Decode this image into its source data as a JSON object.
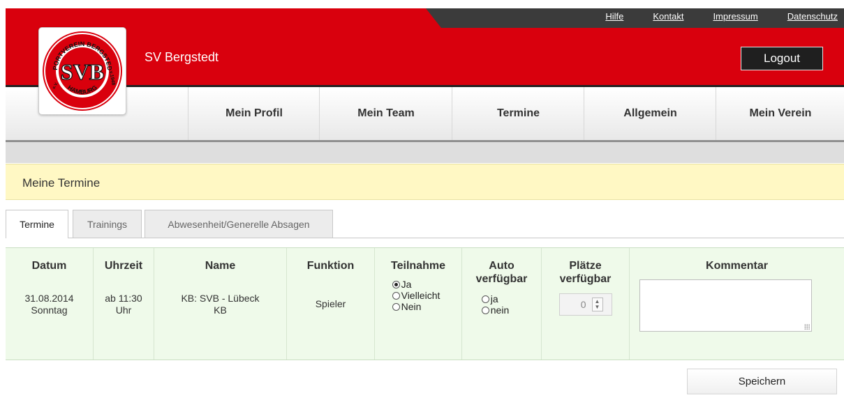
{
  "header": {
    "club_name": "SV Bergstedt",
    "logout_label": "Logout",
    "top_links": [
      "Hilfe",
      "Kontakt",
      "Impressum",
      "Datenschutz"
    ],
    "logo": {
      "top_text": "SPORTVEREIN BERGSTEDT",
      "center_text": "SVB",
      "year_text": "v.1948",
      "bottom_text": "HAMBURG",
      "suffix": "e.V."
    },
    "colors": {
      "brand_red": "#d9000d",
      "topbar": "#3b3b3b"
    }
  },
  "nav": {
    "items": [
      "Mein Profil",
      "Mein Team",
      "Termine",
      "Allgemein",
      "Mein Verein"
    ]
  },
  "section_title": "Meine Termine",
  "tabs": [
    {
      "label": "Termine",
      "active": true
    },
    {
      "label": "Trainings",
      "active": false
    },
    {
      "label": "Abwesenheit/Generelle Absagen",
      "active": false
    }
  ],
  "table": {
    "headers": {
      "datum": "Datum",
      "uhrzeit": "Uhrzeit",
      "name": "Name",
      "funktion": "Funktion",
      "teilnahme": "Teilnahme",
      "auto_1": "Auto",
      "auto_2": "verfügbar",
      "plaetze_1": "Plätze",
      "plaetze_2": "verfügbar",
      "kommentar": "Kommentar"
    },
    "row": {
      "date": "31.08.2014",
      "weekday": "Sonntag",
      "time_1": "ab 11:30",
      "time_2": "Uhr",
      "name_1": "KB: SVB - Lübeck",
      "name_2": "KB",
      "function": "Spieler",
      "teilnahme_options": [
        "Ja",
        "Vielleicht",
        "Nein"
      ],
      "teilnahme_selected": "Ja",
      "auto_options": [
        "ja",
        "nein"
      ],
      "auto_selected": "",
      "plaetze_value": "0",
      "kommentar_value": ""
    }
  },
  "save_label": "Speichern"
}
